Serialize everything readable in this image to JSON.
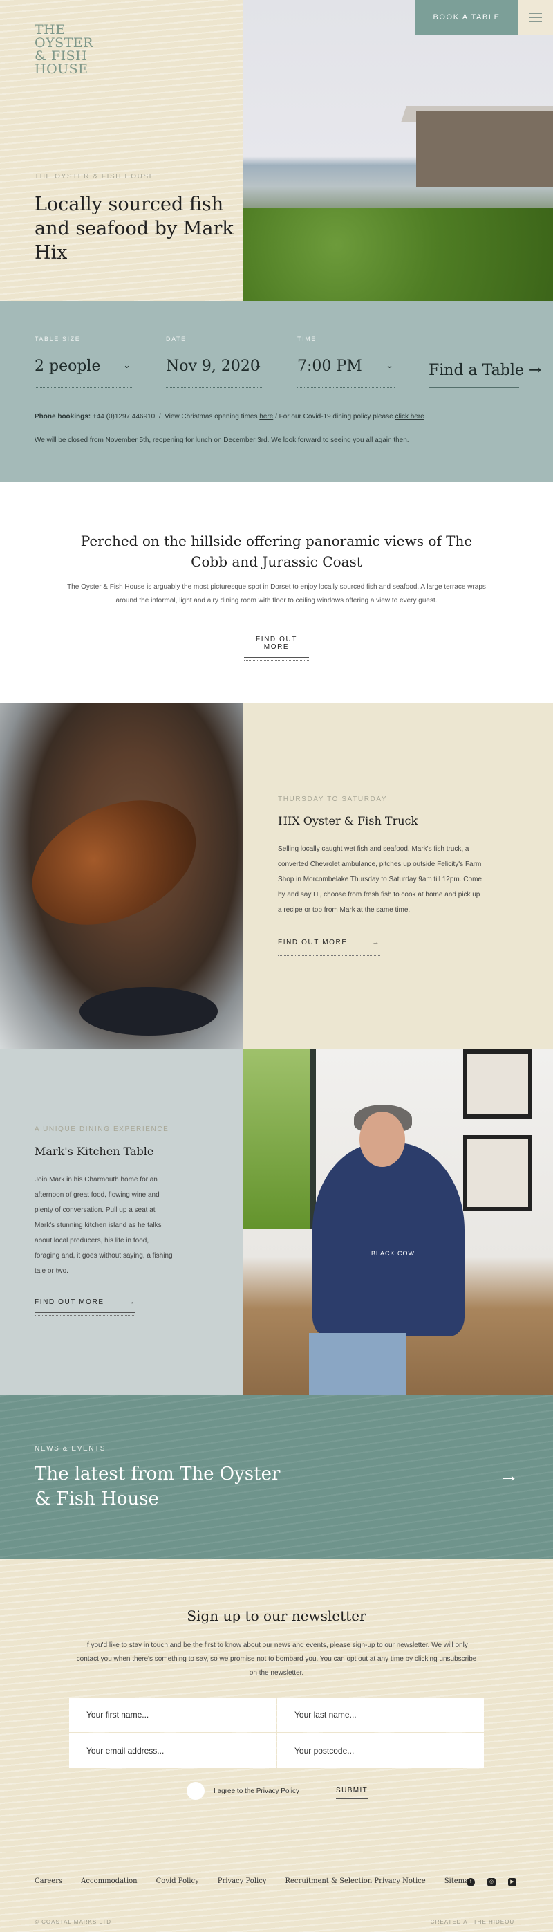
{
  "header": {
    "logo_lines": [
      "THE",
      "OYSTER",
      "& FISH",
      "HOUSE"
    ],
    "book_label": "BOOK A TABLE",
    "kicker": "THE OYSTER & FISH HOUSE",
    "headline": "Locally sourced fish and seafood by Mark Hix"
  },
  "booking": {
    "table_size_label": "TABLE SIZE",
    "table_size_value": "2 people",
    "date_label": "DATE",
    "date_value": "Nov 9, 2020",
    "time_label": "TIME",
    "time_value": "7:00 PM",
    "find_label": "Find a Table →",
    "phone_label": "Phone bookings:",
    "phone_number": "+44 (0)1297 446910",
    "sep": "/",
    "xmas_prefix": "View Christmas opening times",
    "xmas_link": "here",
    "covid_prefix": "/ For our Covid-19 dining policy please",
    "covid_link": "click here",
    "closed_note": "We will be closed from November 5th, reopening for lunch on December 3rd. We look forward to seeing you all again then."
  },
  "intro": {
    "heading": "Perched on the hillside offering panoramic views of The Cobb and Jurassic Coast",
    "body": "The Oyster & Fish House is arguably the most picturesque spot in Dorset to enjoy locally sourced fish and seafood. A large terrace wraps around the informal, light and airy dining room with floor to ceiling windows offering a view to every guest.",
    "more": "FIND OUT MORE"
  },
  "truck": {
    "kicker": "THURSDAY TO SATURDAY",
    "title": "HIX Oyster & Fish Truck",
    "body": "Selling locally caught wet fish and seafood, Mark's fish truck, a converted Chevrolet ambulance, pitches up outside Felicity's Farm Shop in Morcombelake Thursday to Saturday 9am till 12pm. Come by and say Hi, choose from fresh fish to cook at home and pick up a recipe or top from Mark at the same time.",
    "more": "FIND OUT MORE",
    "arrow": "→"
  },
  "kitchen": {
    "kicker": "A UNIQUE DINING EXPERIENCE",
    "title": "Mark's Kitchen Table",
    "body": "Join Mark in his Charmouth home for an afternoon of great food, flowing wine and plenty of conversation. Pull up a seat at Mark's stunning kitchen island as he talks about local producers, his life in food, foraging and, it goes without saying, a fishing tale or two.",
    "more": "FIND OUT MORE",
    "arrow": "→",
    "tee_text": "BLACK COW"
  },
  "news": {
    "kicker": "NEWS & EVENTS",
    "heading": "The latest from The Oyster & Fish House",
    "arrow": "→"
  },
  "newsletter": {
    "heading": "Sign up to our newsletter",
    "body": "If you'd like to stay in touch and be the first to know about our news and events, please sign-up to our newsletter. We will only contact you when there's something to say, so we promise not to bombard you. You can opt out at any time by clicking unsubscribe on the newsletter.",
    "first_name_placeholder": "Your first name...",
    "last_name_placeholder": "Your last name...",
    "email_placeholder": "Your email address...",
    "postcode_placeholder": "Your postcode...",
    "agree_prefix": "I agree to the",
    "privacy_link": "Privacy Policy",
    "submit": "SUBMIT"
  },
  "footer": {
    "links": [
      "Careers",
      "Accommodation",
      "Covid Policy",
      "Privacy Policy",
      "Recruitment & Selection Privacy Notice",
      "Sitemap"
    ],
    "copyright": "© COASTAL MARKS LTD",
    "credit": "CREATED AT THE HIDEOUT"
  },
  "colors": {
    "cream": "#ede5ce",
    "sage": "#a4bab8",
    "teal": "#6f948c",
    "button": "#7c9f98"
  }
}
